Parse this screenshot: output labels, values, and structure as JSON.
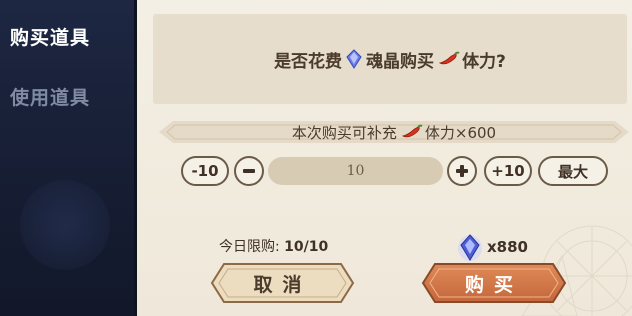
{
  "sidebar": {
    "items": [
      {
        "label": "购买道具",
        "active": true
      },
      {
        "label": "使用道具",
        "active": false
      }
    ]
  },
  "dialog": {
    "question_part1": "是否花费",
    "question_part2": "魂晶购买",
    "question_part3": "体力?",
    "refill_prefix": "本次购买可补充",
    "refill_suffix": "体力×600",
    "stepper": {
      "minus10_label": "-10",
      "quantity": "10",
      "plus10_label": "+10",
      "max_label": "最大"
    },
    "limit_label": "今日限购:",
    "limit_value": "10/10",
    "cost_value": "x880",
    "cancel_label": "取消",
    "buy_label": "购买"
  },
  "colors": {
    "panel_bg": "#f2ecdf",
    "sidebar_bg": "#1b2338",
    "buy_button": "#d2764a",
    "cancel_button": "#ecdcc0"
  },
  "icons": {
    "currency": "soul-crystal-icon",
    "stamina": "chili-pepper-icon"
  }
}
